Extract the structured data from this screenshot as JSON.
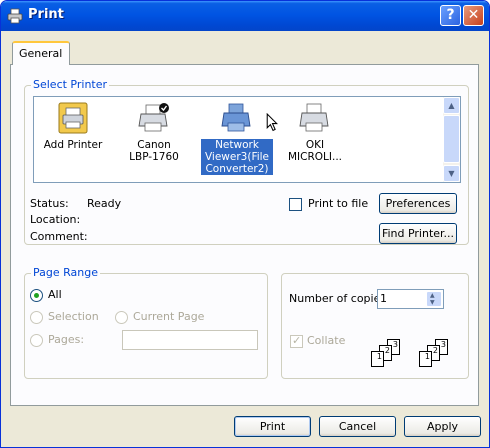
{
  "window": {
    "title": "Print",
    "help_button": "?",
    "close_button": "✕"
  },
  "tabs": [
    {
      "label": "General"
    }
  ],
  "select_printer": {
    "label": "Select Printer",
    "printers": [
      {
        "label": "Add Printer",
        "icon": "add-printer-icon",
        "selected": false
      },
      {
        "label": "Canon LBP-1760",
        "icon": "printer-default-icon",
        "selected": false
      },
      {
        "label": "Network Viewer3(File Converter2)",
        "icon": "printer-icon",
        "selected": true
      },
      {
        "label": "OKI MICROLI...",
        "icon": "printer-icon",
        "selected": false
      }
    ],
    "status_label": "Status:",
    "status_value": "Ready",
    "location_label": "Location:",
    "location_value": "",
    "comment_label": "Comment:",
    "comment_value": "",
    "print_to_file_label": "Print to file",
    "print_to_file_checked": false,
    "preferences_button": "Preferences",
    "find_printer_button": "Find Printer..."
  },
  "page_range": {
    "label": "Page Range",
    "options": {
      "all": "All",
      "selection": "Selection",
      "current_page": "Current Page",
      "pages": "Pages:"
    },
    "selected": "all",
    "pages_value": ""
  },
  "copies": {
    "number_label": "Number of copies:",
    "number_value": "1",
    "collate_label": "Collate",
    "collate_checked": true,
    "collate_icon_pages": [
      "1",
      "2",
      "3"
    ]
  },
  "footer": {
    "print_button": "Print",
    "cancel_button": "Cancel",
    "apply_button": "Apply"
  },
  "colors": {
    "titlebar": "#0054e3",
    "dialog_bg": "#ece9d8",
    "group_label": "#0046d5",
    "selection": "#316ac5"
  }
}
